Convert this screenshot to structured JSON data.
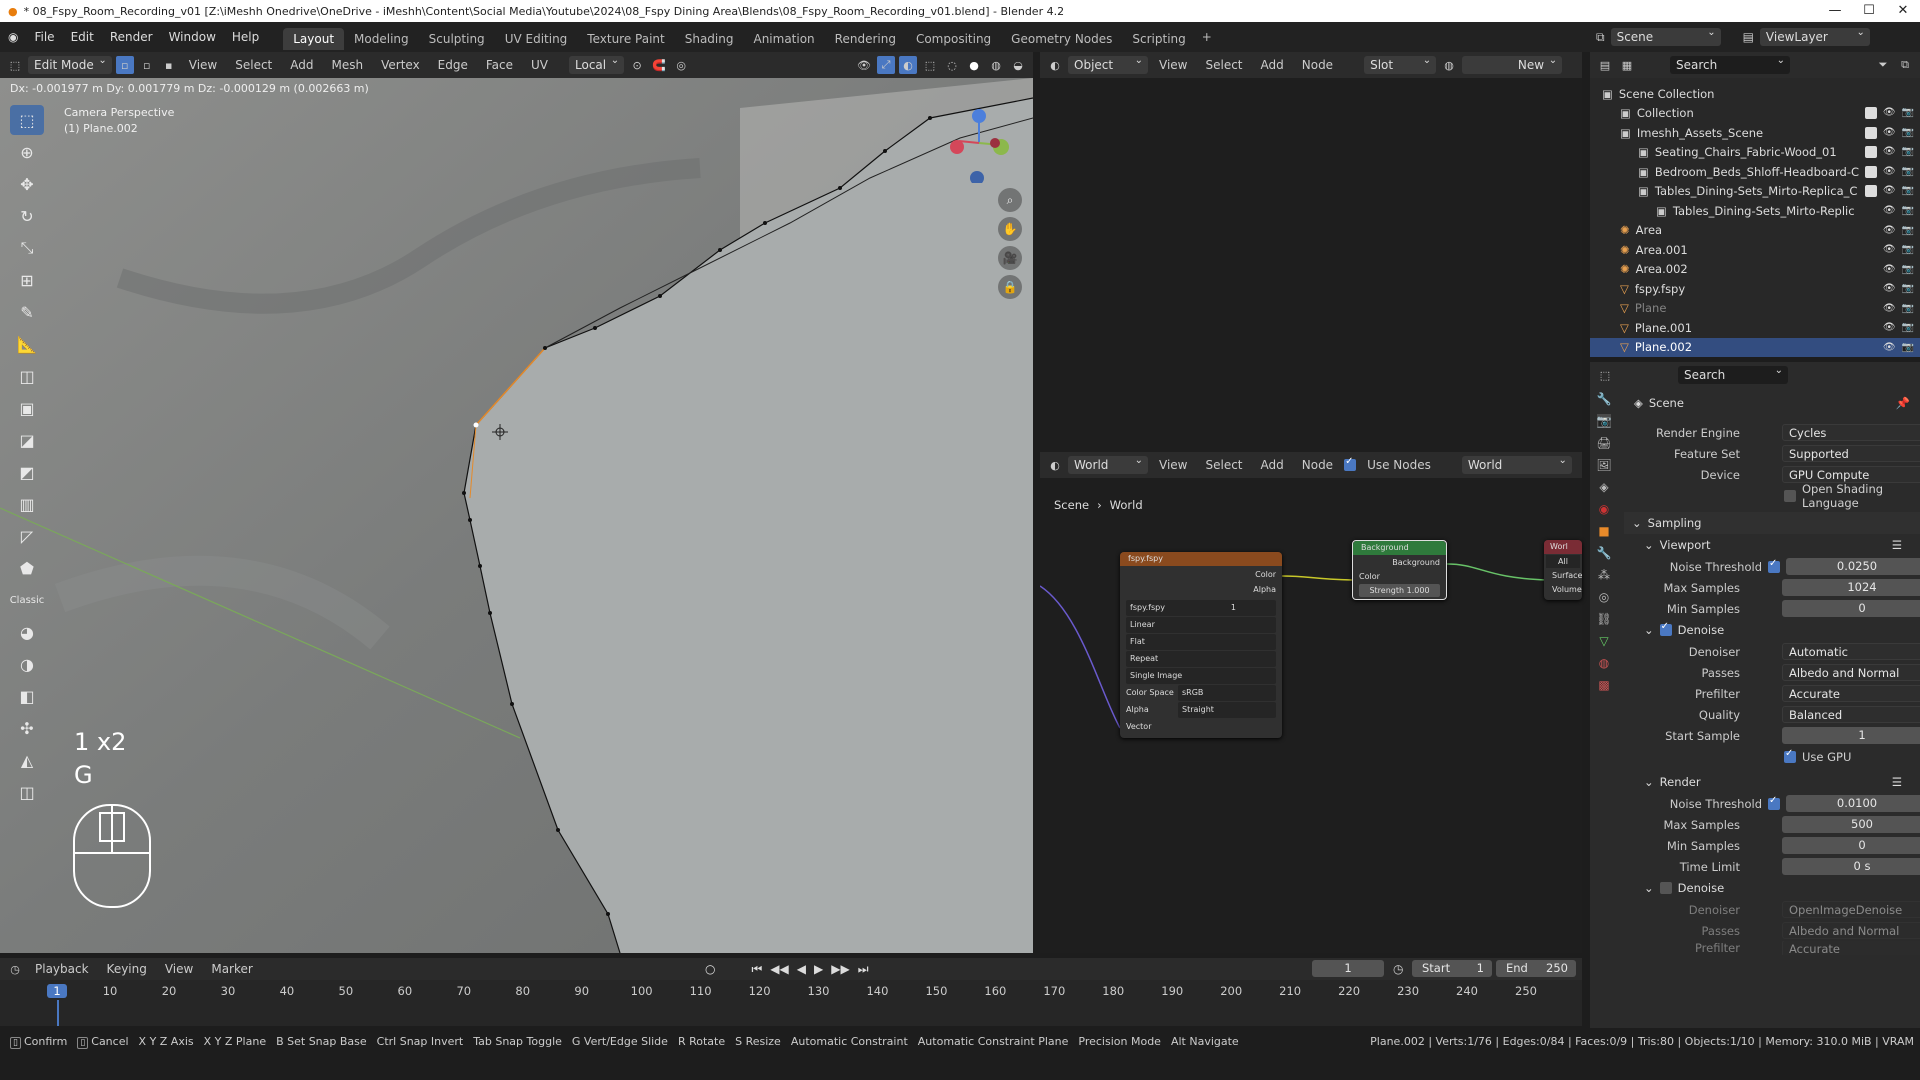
{
  "title_bar": {
    "text": "* 08_Fspy_Room_Recording_v01 [Z:\\iMeshh Onedrive\\OneDrive - iMeshh\\Content\\Social Media\\Youtube\\2024\\08_Fspy Dining Area\\Blends\\08_Fspy_Room_Recording_v01.blend] - Blender 4.2"
  },
  "menu": {
    "items": [
      "File",
      "Edit",
      "Render",
      "Window",
      "Help"
    ],
    "workspaces": [
      "Layout",
      "Modeling",
      "Sculpting",
      "UV Editing",
      "Texture Paint",
      "Shading",
      "Animation",
      "Rendering",
      "Compositing",
      "Geometry Nodes",
      "Scripting"
    ],
    "active_workspace": "Layout",
    "scene": "Scene",
    "view_layer": "ViewLayer"
  },
  "viewport": {
    "mode": "Edit Mode",
    "menus": [
      "View",
      "Select",
      "Add",
      "Mesh",
      "Vertex",
      "Edge",
      "Face",
      "UV"
    ],
    "orientation": "Local",
    "header_info": "Dx: -0.001977 m  Dy: 0.001779 m  Dz: -0.000129 m (0.002663 m)",
    "camera_label": "Camera Perspective",
    "object_label": "(1) Plane.002",
    "key_overlay_1": "1 x2",
    "key_overlay_2": "G",
    "toolbar_label": "Classic"
  },
  "shader_top": {
    "object_dd": "Object",
    "menus": [
      "View",
      "Select",
      "Add",
      "Node"
    ],
    "slot_dd": "Slot",
    "new_label": "New"
  },
  "shader_world": {
    "world_dd": "World",
    "menus": [
      "View",
      "Select",
      "Add",
      "Node"
    ],
    "use_nodes": "Use Nodes",
    "world_name": "World",
    "breadcrumb": [
      "Scene",
      "World"
    ],
    "nodes": {
      "image": {
        "title": "fspy.fspy",
        "out_color": "Color",
        "out_alpha": "Alpha",
        "file": "fspy.fspy",
        "users": "1",
        "options": [
          "Linear",
          "Flat",
          "Repeat",
          "Single Image"
        ],
        "colorspace_label": "Color Space",
        "colorspace_value": "sRGB",
        "alpha_label": "Alpha",
        "alpha_value": "Straight",
        "in_vector": "Vector"
      },
      "background": {
        "title": "Background",
        "out_background": "Background",
        "in_color": "Color",
        "strength_label": "Strength",
        "strength_value": "1.000"
      },
      "output": {
        "title": "Worl",
        "target": "All",
        "surface": "Surface",
        "volume": "Volume"
      }
    }
  },
  "outliner": {
    "search_placeholder": "Search",
    "rows": [
      {
        "label": "Scene Collection",
        "indent": 0
      },
      {
        "label": "Collection",
        "indent": 1
      },
      {
        "label": "Imeshh_Assets_Scene",
        "indent": 1
      },
      {
        "label": "Seating_Chairs_Fabric-Wood_01",
        "indent": 2
      },
      {
        "label": "Bedroom_Beds_Shloff-Headboard-C",
        "indent": 2
      },
      {
        "label": "Tables_Dining-Sets_Mirto-Replica_C",
        "indent": 2
      },
      {
        "label": "Tables_Dining-Sets_Mirto-Replic",
        "indent": 3
      },
      {
        "label": "Area",
        "indent": 1
      },
      {
        "label": "Area.001",
        "indent": 1
      },
      {
        "label": "Area.002",
        "indent": 1
      },
      {
        "label": "fspy.fspy",
        "indent": 1
      },
      {
        "label": "Plane",
        "indent": 1
      },
      {
        "label": "Plane.001",
        "indent": 1
      },
      {
        "label": "Plane.002",
        "indent": 1
      }
    ]
  },
  "properties": {
    "search_placeholder": "Search",
    "context": "Scene",
    "render_engine_label": "Render Engine",
    "render_engine": "Cycles",
    "feature_set_label": "Feature Set",
    "feature_set": "Supported",
    "device_label": "Device",
    "device": "GPU Compute",
    "osl_label": "Open Shading Language",
    "sampling": "Sampling",
    "viewport_section": "Viewport",
    "noise_threshold_label": "Noise Threshold",
    "vp_noise": "0.0250",
    "max_samples_label": "Max Samples",
    "vp_max": "1024",
    "min_samples_label": "Min Samples",
    "vp_min": "0",
    "denoise_label": "Denoise",
    "denoiser_label": "Denoiser",
    "vp_denoiser": "Automatic",
    "passes_label": "Passes",
    "vp_passes": "Albedo and Normal",
    "prefilter_label": "Prefilter",
    "vp_prefilter": "Accurate",
    "quality_label": "Quality",
    "vp_quality": "Balanced",
    "start_sample_label": "Start Sample",
    "vp_start": "1",
    "use_gpu_label": "Use GPU",
    "render_section": "Render",
    "r_noise": "0.0100",
    "r_max": "500",
    "r_min": "0",
    "time_limit_label": "Time Limit",
    "r_time": "0 s",
    "r_denoiser": "OpenImageDenoise",
    "r_passes": "Albedo and Normal",
    "r_prefilter": "Accurate"
  },
  "timeline": {
    "menus": [
      "Playback",
      "Keying",
      "View",
      "Marker"
    ],
    "current_frame": "1",
    "start_label": "Start",
    "start": "1",
    "end_label": "End",
    "end": "250",
    "ticks": [
      "1",
      "10",
      "20",
      "30",
      "40",
      "50",
      "60",
      "70",
      "80",
      "90",
      "100",
      "110",
      "120",
      "130",
      "140",
      "150",
      "160",
      "170",
      "180",
      "190",
      "200",
      "210",
      "220",
      "230",
      "240",
      "250"
    ]
  },
  "statusbar": {
    "items": [
      "Confirm",
      "Cancel",
      "X Y Z Axis",
      "X Y Z Plane",
      "B Set Snap Base",
      "Ctrl Snap Invert",
      "Tab Snap Toggle",
      "G Vert/Edge Slide",
      "R Rotate",
      "S Resize",
      "Automatic Constraint",
      "Automatic Constraint Plane",
      "Precision Mode",
      "Alt Navigate"
    ],
    "stats": "Plane.002 | Verts:1/76 | Edges:0/84 | Faces:0/9 | Tris:80 | Objects:1/10 | Memory: 310.0 MiB | VRAM"
  },
  "colors": {
    "accent": "#4a78c2",
    "selected_row": "#334d80",
    "image_node_header": "#8a4a1e",
    "background_node_header": "#2f7a3c",
    "output_node_header": "#7a2c35"
  }
}
